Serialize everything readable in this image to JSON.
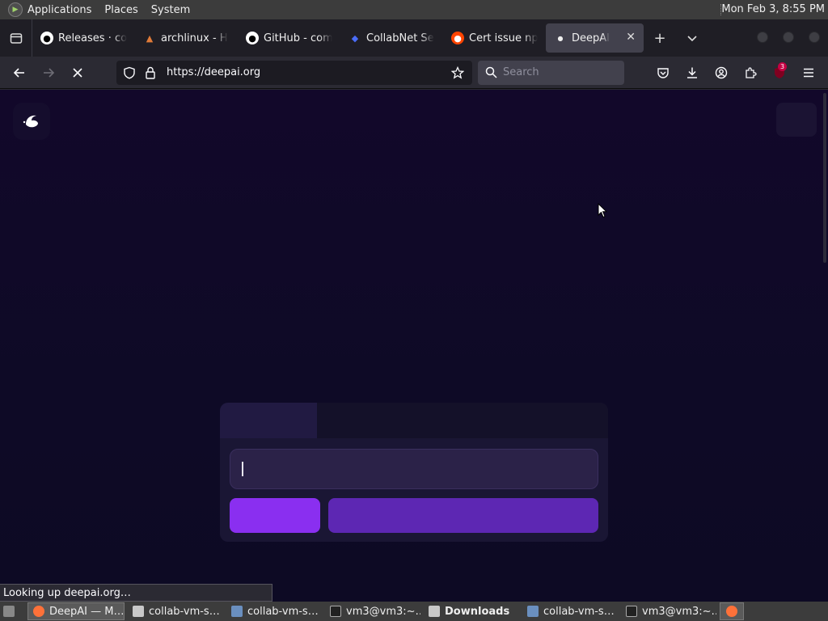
{
  "top_panel": {
    "menus": [
      "Applications",
      "Places",
      "System"
    ],
    "clock": "Mon Feb  3,  8:55 PM"
  },
  "tabs": [
    {
      "label": "Releases · co",
      "icon": "github-icon"
    },
    {
      "label": "archlinux - H",
      "icon": "archlinux-icon"
    },
    {
      "label": "GitHub - com",
      "icon": "github-icon"
    },
    {
      "label": "CollabNet Se",
      "icon": "collabnet-icon"
    },
    {
      "label": "Cert issue np",
      "icon": "reddit-icon"
    },
    {
      "label": "DeepAI",
      "icon": "loading-dot-icon",
      "active": true
    }
  ],
  "nav": {
    "url": "https://deepai.org",
    "search_placeholder": "Search",
    "extension_badge": "3"
  },
  "status_text": "Looking up deepai.org…",
  "taskbar": [
    {
      "label": "DeepAI — M…",
      "icon": "firefox-icon",
      "active": true
    },
    {
      "label": "collab-vm-s…",
      "icon": "folder-icon"
    },
    {
      "label": "collab-vm-s…",
      "icon": "editor-icon"
    },
    {
      "label": "vm3@vm3:~…",
      "icon": "terminal-icon"
    },
    {
      "label": "Downloads",
      "icon": "folder-icon",
      "bold": true
    },
    {
      "label": "collab-vm-s…",
      "icon": "editor-icon"
    },
    {
      "label": "vm3@vm3:~…",
      "icon": "terminal-icon"
    }
  ],
  "colors": {
    "page_bg": "#0e0a26",
    "accent_primary": "#8a2ff0",
    "accent_secondary": "#5d27b3"
  }
}
